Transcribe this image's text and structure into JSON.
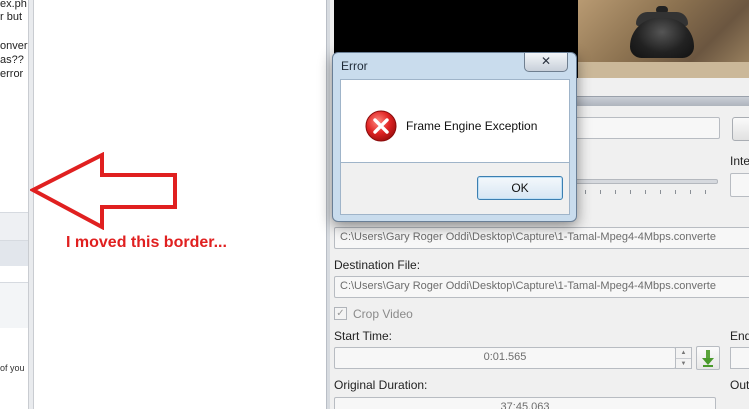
{
  "left_pane": {
    "fragments": [
      "ex.ph",
      "r but",
      "onver",
      "as??",
      "error"
    ],
    "bottom_fragment": "of you"
  },
  "annotation": {
    "text": "I moved this border...",
    "color": "#e02020"
  },
  "app": {
    "inte_label": "Inte",
    "source_path": "C:\\Users\\Gary Roger Oddi\\Desktop\\Capture\\1-Tamal-Mpeg4-4Mbps.converte",
    "destination_label": "Destination File:",
    "destination_path": "C:\\Users\\Gary Roger Oddi\\Desktop\\Capture\\1-Tamal-Mpeg4-4Mbps.converte",
    "crop_label": "Crop Video",
    "crop_checked": true,
    "start_time_label": "Start Time:",
    "start_time_value": "0:01.565",
    "end_label": "End",
    "original_duration_label": "Original Duration:",
    "original_duration_value": "37:45.063",
    "out_label": "Out"
  },
  "dialog": {
    "title": "Error",
    "close_glyph": "✕",
    "message": "Frame Engine Exception",
    "ok_label": "OK",
    "icon": "error-x-icon"
  },
  "colors": {
    "accent_red": "#e02020",
    "dialog_frame": "#c9dced",
    "ok_border": "#3c7fb1"
  }
}
